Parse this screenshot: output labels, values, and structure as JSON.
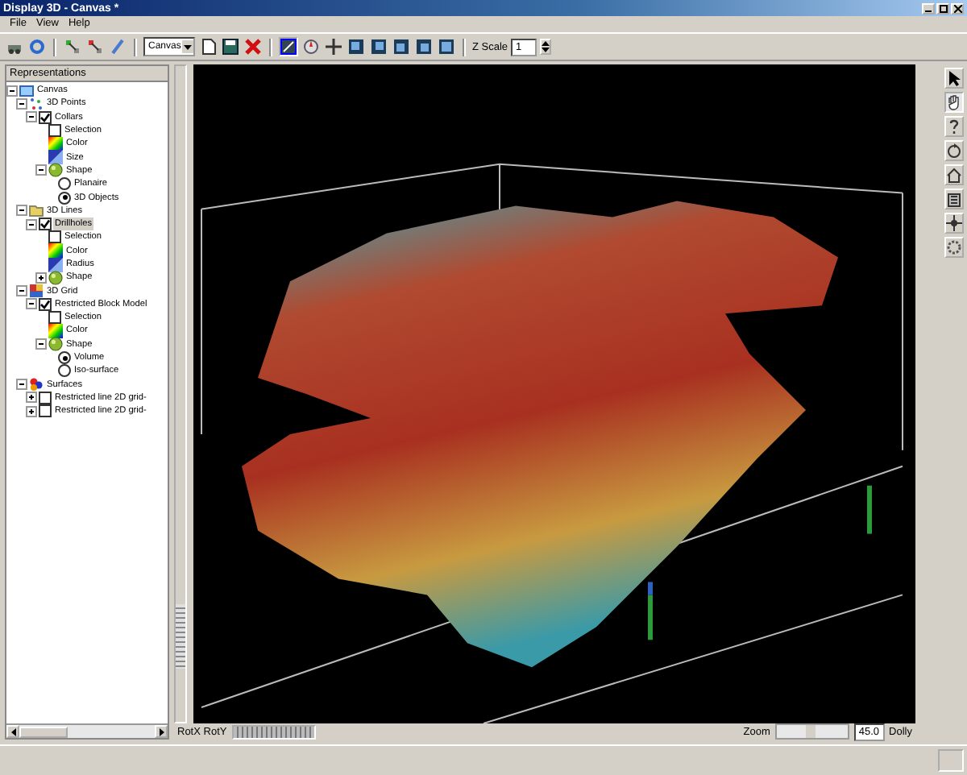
{
  "window": {
    "title": "Display 3D - Canvas *"
  },
  "menu": [
    "File",
    "View",
    "Help"
  ],
  "toolbar": {
    "view_combo": "Canvas",
    "zscale_label": "Z Scale",
    "zscale_value": "1"
  },
  "tree": {
    "title": "Representations",
    "items": [
      {
        "label": "Canvas",
        "kind": "canvas",
        "selected": false,
        "expanded": true,
        "children": [
          {
            "label": "3D Points",
            "kind": "points",
            "selected": false,
            "expanded": true,
            "children": [
              {
                "label": "Collars",
                "kind": "checkbox",
                "checked": true,
                "selected": false,
                "expanded": true,
                "children": [
                  {
                    "label": "Selection",
                    "kind": "checkbox",
                    "checked": false,
                    "selected": false
                  },
                  {
                    "label": "Color",
                    "kind": "color",
                    "selected": false
                  },
                  {
                    "label": "Size",
                    "kind": "size",
                    "selected": false
                  },
                  {
                    "label": "Shape",
                    "kind": "shape",
                    "selected": false,
                    "expanded": true,
                    "children": [
                      {
                        "label": "Planaire",
                        "kind": "radio",
                        "checked": false,
                        "selected": false
                      },
                      {
                        "label": "3D Objects",
                        "kind": "radio",
                        "checked": true,
                        "selected": false
                      }
                    ]
                  }
                ]
              }
            ]
          },
          {
            "label": "3D Lines",
            "kind": "lines",
            "selected": false,
            "expanded": true,
            "children": [
              {
                "label": "Drillholes",
                "kind": "checkbox",
                "checked": true,
                "selected": true,
                "expanded": true,
                "children": [
                  {
                    "label": "Selection",
                    "kind": "checkbox",
                    "checked": false,
                    "selected": false
                  },
                  {
                    "label": "Color",
                    "kind": "color",
                    "selected": false
                  },
                  {
                    "label": "Radius",
                    "kind": "size",
                    "selected": false
                  },
                  {
                    "label": "Shape",
                    "kind": "shape",
                    "selected": false,
                    "expanded": false
                  }
                ]
              }
            ]
          },
          {
            "label": "3D Grid",
            "kind": "grid",
            "selected": false,
            "expanded": true,
            "children": [
              {
                "label": "Restricted Block Model",
                "kind": "checkbox",
                "checked": true,
                "selected": false,
                "expanded": true,
                "children": [
                  {
                    "label": "Selection",
                    "kind": "checkbox",
                    "checked": false,
                    "selected": false
                  },
                  {
                    "label": "Color",
                    "kind": "color",
                    "selected": false
                  },
                  {
                    "label": "Shape",
                    "kind": "shape",
                    "selected": false,
                    "expanded": true,
                    "children": [
                      {
                        "label": "Volume",
                        "kind": "radio",
                        "checked": true,
                        "selected": false
                      },
                      {
                        "label": "Iso-surface",
                        "kind": "radio",
                        "checked": false,
                        "selected": false
                      }
                    ]
                  }
                ]
              }
            ]
          },
          {
            "label": "Surfaces",
            "kind": "surfaces",
            "selected": false,
            "expanded": true,
            "children": [
              {
                "label": "Restricted line 2D grid-",
                "kind": "checkbox",
                "checked": false,
                "selected": false,
                "expanded": false
              },
              {
                "label": "Restricted line 2D grid-",
                "kind": "checkbox",
                "checked": false,
                "selected": false,
                "expanded": false
              }
            ]
          }
        ]
      }
    ]
  },
  "elevation_slider": {
    "level": 0.08
  },
  "bottom": {
    "rot_label": "RotX RotY",
    "zoom_label": "Zoom",
    "zoom_value": "45.0",
    "dolly_label": "Dolly"
  }
}
